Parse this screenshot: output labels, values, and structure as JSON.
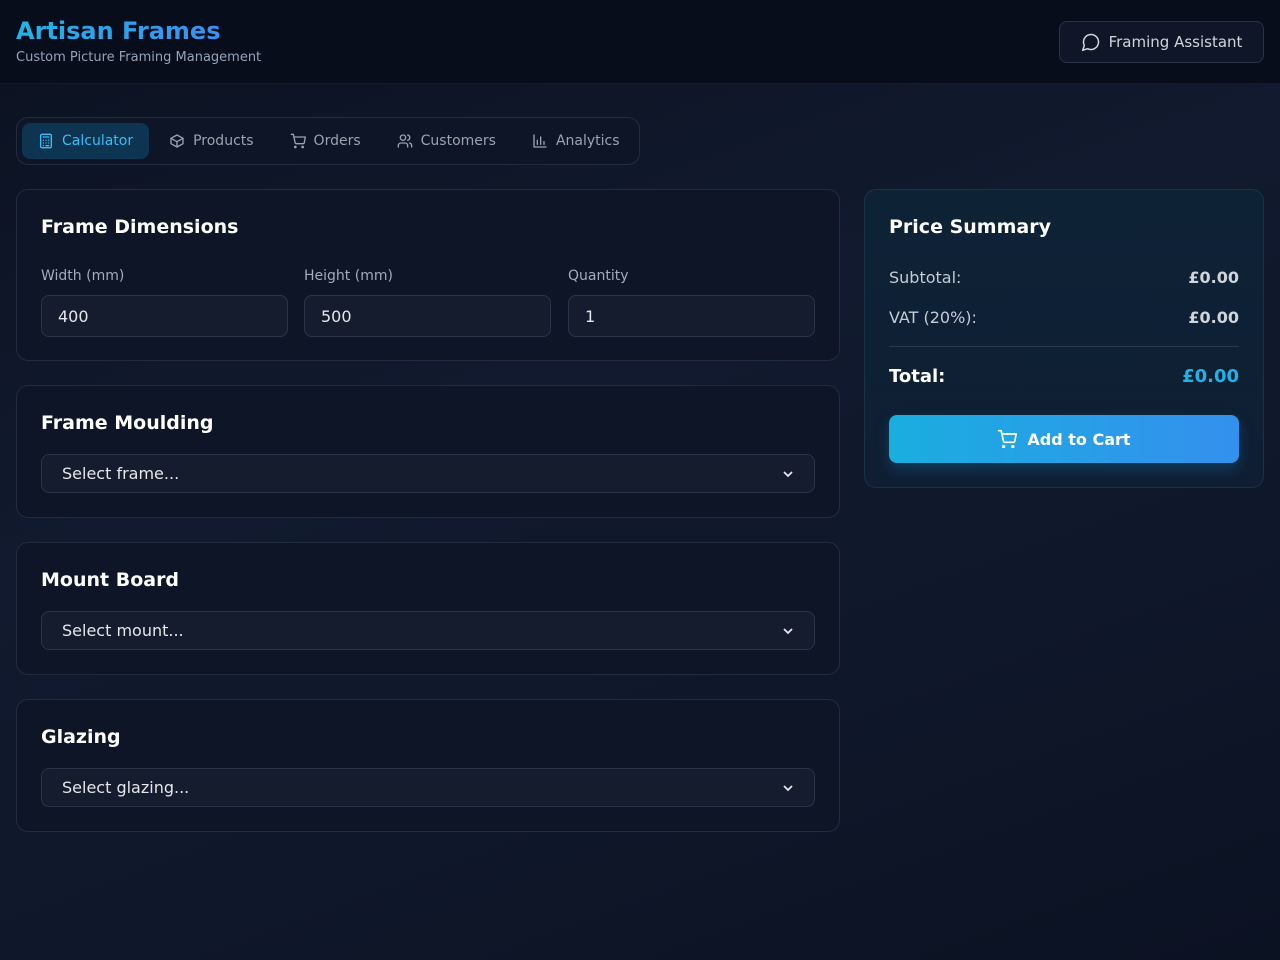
{
  "header": {
    "title": "Artisan Frames",
    "subtitle": "Custom Picture Framing Management",
    "assistant_label": "Framing Assistant"
  },
  "tabs": [
    {
      "label": "Calculator",
      "icon": "calculator-icon",
      "active": true
    },
    {
      "label": "Products",
      "icon": "box-icon",
      "active": false
    },
    {
      "label": "Orders",
      "icon": "cart-icon",
      "active": false
    },
    {
      "label": "Customers",
      "icon": "users-icon",
      "active": false
    },
    {
      "label": "Analytics",
      "icon": "bar-chart-icon",
      "active": false
    }
  ],
  "dimensions": {
    "title": "Frame Dimensions",
    "width_label": "Width (mm)",
    "width_value": "400",
    "height_label": "Height (mm)",
    "height_value": "500",
    "quantity_label": "Quantity",
    "quantity_value": "1"
  },
  "frame": {
    "title": "Frame Moulding",
    "selected": "Select frame..."
  },
  "mount": {
    "title": "Mount Board",
    "selected": "Select mount..."
  },
  "glazing": {
    "title": "Glazing",
    "selected": "Select glazing..."
  },
  "summary": {
    "title": "Price Summary",
    "subtotal_label": "Subtotal:",
    "subtotal_value": "£0.00",
    "vat_label": "VAT (20%):",
    "vat_value": "£0.00",
    "total_label": "Total:",
    "total_value": "£0.00",
    "cart_label": "Add to Cart"
  },
  "colors": {
    "accent": "#22b3e6",
    "accent_end": "#3490ee",
    "background": "#0f172a",
    "active_tab_bg": "#0d3450"
  }
}
